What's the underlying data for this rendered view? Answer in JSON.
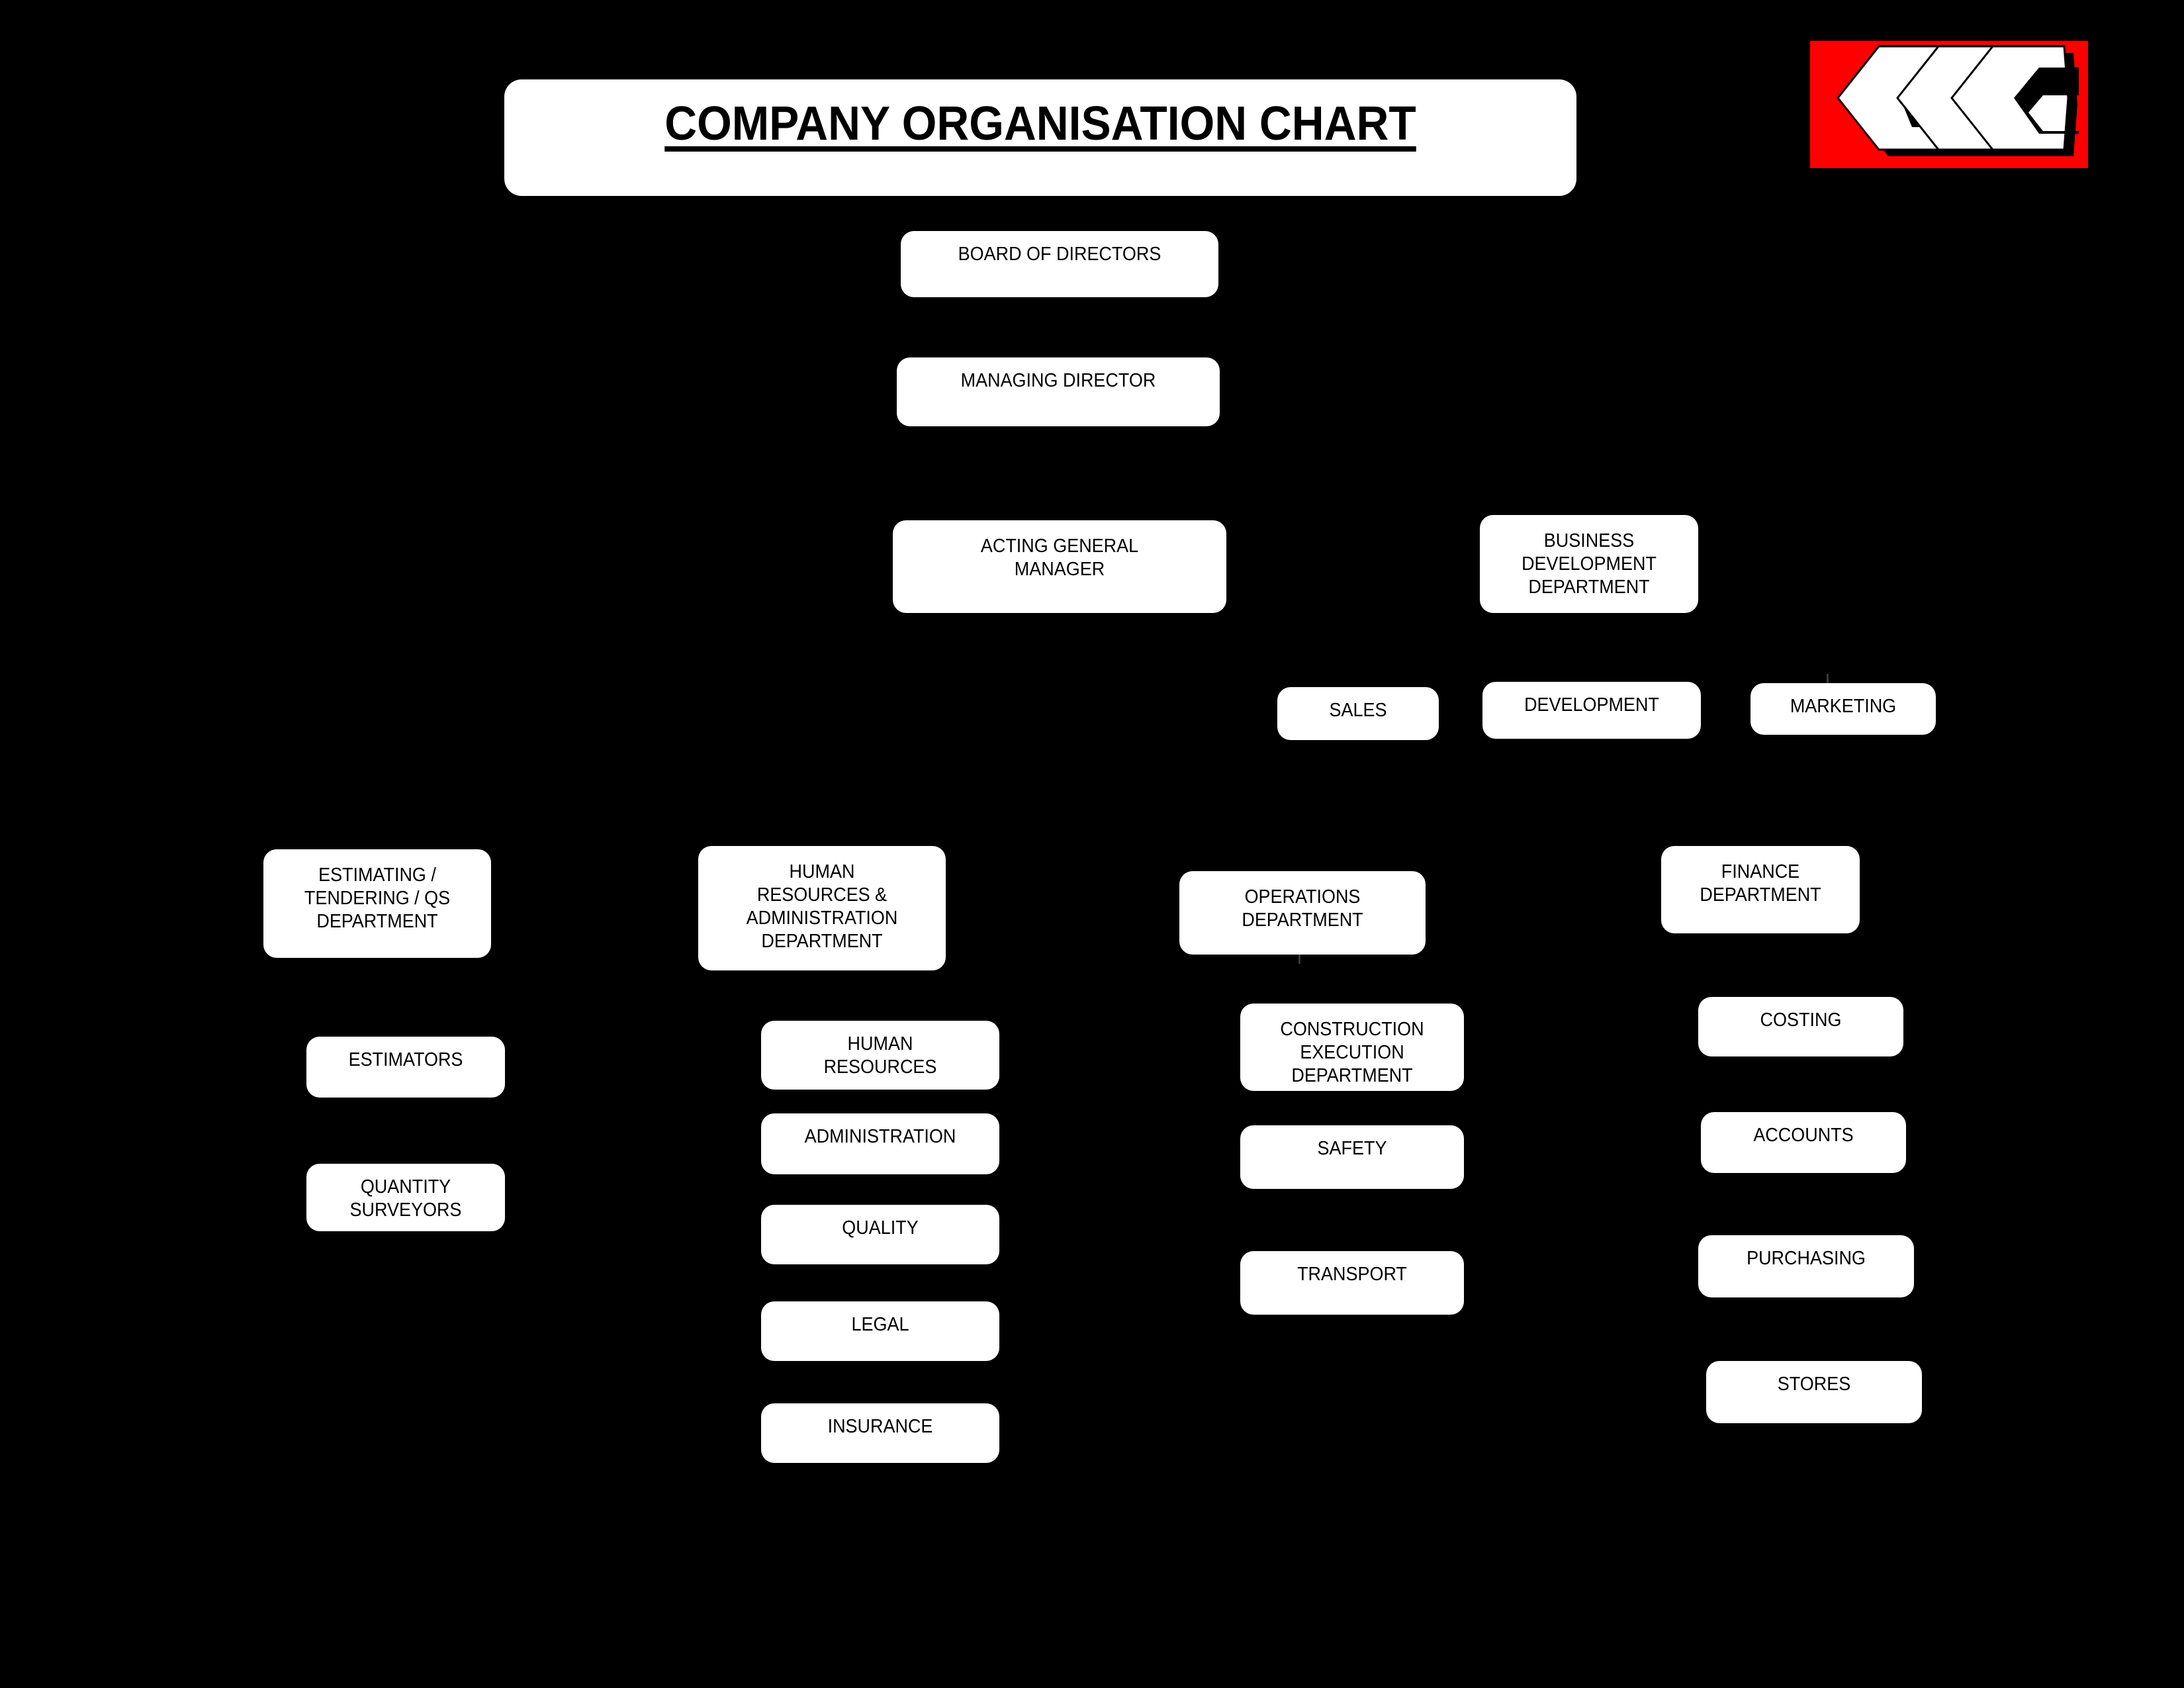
{
  "page": {
    "background_color": "#000000",
    "title": "COMPANY ORGANISATION CHART"
  },
  "logo": {
    "text": "GCC",
    "background_color": "#FE0000",
    "glyph_color": "#FFFFFF",
    "shadow_color": "#000000",
    "name": "gcc-logo"
  },
  "nodes": {
    "board_of_directors": "BOARD OF DIRECTORS",
    "managing_director": "MANAGING DIRECTOR",
    "acting_general_manager": "ACTING GENERAL\nMANAGER",
    "business_development_department": "BUSINESS\nDEVELOPMENT\nDEPARTMENT",
    "sales": "SALES",
    "development": "DEVELOPMENT",
    "marketing": "MARKETING",
    "estimating_department": "ESTIMATING /\nTENDERING / QS\nDEPARTMENT",
    "estimators": "ESTIMATORS",
    "quantity_surveyors": "QUANTITY\nSURVEYORS",
    "hr_admin_department": "HUMAN\nRESOURCES &\nADMINISTRATION\nDEPARTMENT",
    "human_resources": "HUMAN\nRESOURCES",
    "administration": "ADMINISTRATION",
    "quality": "QUALITY",
    "legal": "LEGAL",
    "insurance": "INSURANCE",
    "operations_department": "OPERATIONS\nDEPARTMENT",
    "construction_execution_department": "CONSTRUCTION\nEXECUTION\nDEPARTMENT",
    "safety": "SAFETY",
    "transport": "TRANSPORT",
    "finance_department": "FINANCE\nDEPARTMENT",
    "costing": "COSTING",
    "accounts": "ACCOUNTS",
    "purchasing": "PURCHASING",
    "stores": "STORES"
  },
  "chart_data": {
    "type": "diagram",
    "title": "COMPANY ORGANISATION CHART",
    "diagram_kind": "organisation-chart",
    "levels": [
      {
        "level": 1,
        "nodes": [
          "BOARD OF DIRECTORS"
        ]
      },
      {
        "level": 2,
        "nodes": [
          "MANAGING DIRECTOR"
        ]
      },
      {
        "level": 3,
        "nodes": [
          "ACTING GENERAL MANAGER",
          "BUSINESS DEVELOPMENT DEPARTMENT"
        ]
      },
      {
        "level": 4,
        "nodes": [
          "SALES",
          "DEVELOPMENT",
          "MARKETING"
        ]
      },
      {
        "level": 5,
        "nodes": [
          "ESTIMATING / TENDERING / QS DEPARTMENT",
          "HUMAN RESOURCES & ADMINISTRATION DEPARTMENT",
          "OPERATIONS DEPARTMENT",
          "FINANCE DEPARTMENT"
        ]
      },
      {
        "level": 6,
        "nodes": [
          "ESTIMATORS",
          "QUANTITY SURVEYORS",
          "HUMAN RESOURCES",
          "ADMINISTRATION",
          "QUALITY",
          "LEGAL",
          "INSURANCE",
          "CONSTRUCTION EXECUTION DEPARTMENT",
          "SAFETY",
          "TRANSPORT",
          "COSTING",
          "ACCOUNTS",
          "PURCHASING",
          "STORES"
        ]
      }
    ],
    "edges": [
      {
        "from": "BOARD OF DIRECTORS",
        "to": "MANAGING DIRECTOR"
      },
      {
        "from": "MANAGING DIRECTOR",
        "to": "ACTING GENERAL MANAGER"
      },
      {
        "from": "MANAGING DIRECTOR",
        "to": "BUSINESS DEVELOPMENT DEPARTMENT"
      },
      {
        "from": "BUSINESS DEVELOPMENT DEPARTMENT",
        "to": "SALES"
      },
      {
        "from": "BUSINESS DEVELOPMENT DEPARTMENT",
        "to": "DEVELOPMENT"
      },
      {
        "from": "BUSINESS DEVELOPMENT DEPARTMENT",
        "to": "MARKETING"
      },
      {
        "from": "ACTING GENERAL MANAGER",
        "to": "ESTIMATING / TENDERING / QS DEPARTMENT"
      },
      {
        "from": "ACTING GENERAL MANAGER",
        "to": "HUMAN RESOURCES & ADMINISTRATION DEPARTMENT"
      },
      {
        "from": "ACTING GENERAL MANAGER",
        "to": "OPERATIONS DEPARTMENT"
      },
      {
        "from": "ACTING GENERAL MANAGER",
        "to": "FINANCE DEPARTMENT"
      },
      {
        "from": "ESTIMATING / TENDERING / QS DEPARTMENT",
        "to": "ESTIMATORS"
      },
      {
        "from": "ESTIMATING / TENDERING / QS DEPARTMENT",
        "to": "QUANTITY SURVEYORS"
      },
      {
        "from": "HUMAN RESOURCES & ADMINISTRATION DEPARTMENT",
        "to": "HUMAN RESOURCES"
      },
      {
        "from": "HUMAN RESOURCES & ADMINISTRATION DEPARTMENT",
        "to": "ADMINISTRATION"
      },
      {
        "from": "HUMAN RESOURCES & ADMINISTRATION DEPARTMENT",
        "to": "QUALITY"
      },
      {
        "from": "HUMAN RESOURCES & ADMINISTRATION DEPARTMENT",
        "to": "LEGAL"
      },
      {
        "from": "HUMAN RESOURCES & ADMINISTRATION DEPARTMENT",
        "to": "INSURANCE"
      },
      {
        "from": "OPERATIONS DEPARTMENT",
        "to": "CONSTRUCTION EXECUTION DEPARTMENT"
      },
      {
        "from": "OPERATIONS DEPARTMENT",
        "to": "SAFETY"
      },
      {
        "from": "OPERATIONS DEPARTMENT",
        "to": "TRANSPORT"
      },
      {
        "from": "FINANCE DEPARTMENT",
        "to": "COSTING"
      },
      {
        "from": "FINANCE DEPARTMENT",
        "to": "ACCOUNTS"
      },
      {
        "from": "FINANCE DEPARTMENT",
        "to": "PURCHASING"
      },
      {
        "from": "FINANCE DEPARTMENT",
        "to": "STORES"
      }
    ]
  }
}
